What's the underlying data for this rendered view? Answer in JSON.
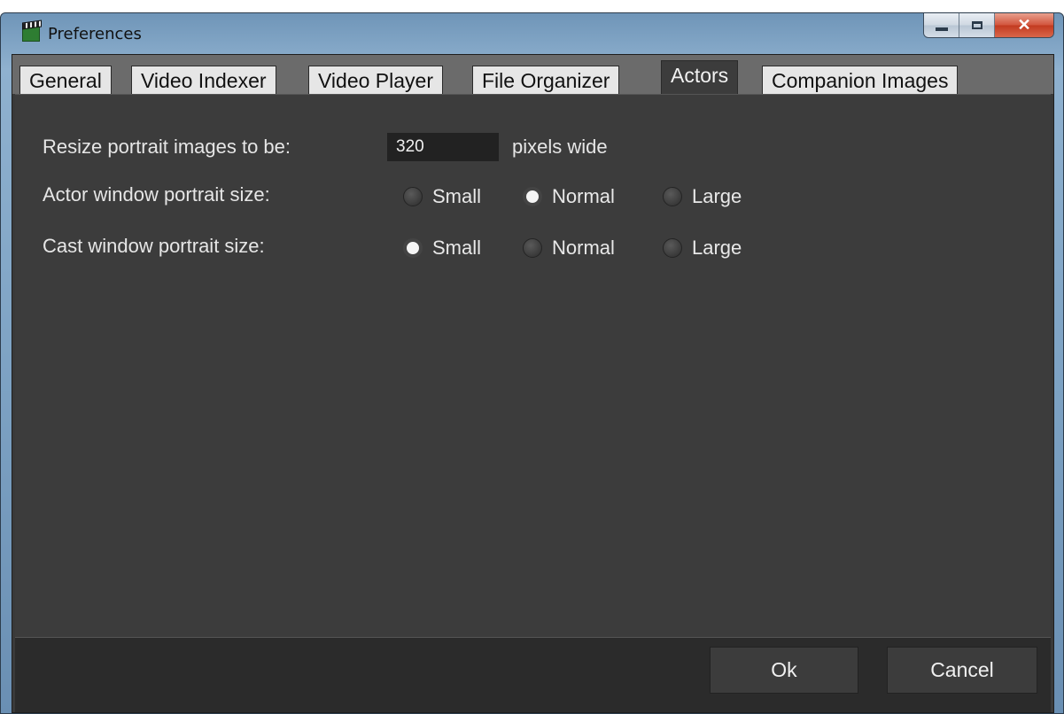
{
  "window": {
    "title": "Preferences"
  },
  "tabs": [
    {
      "label": "General",
      "active": false
    },
    {
      "label": "Video Indexer",
      "active": false
    },
    {
      "label": "Video Player",
      "active": false
    },
    {
      "label": "File Organizer",
      "active": false
    },
    {
      "label": "Actors",
      "active": true
    },
    {
      "label": "Companion Images",
      "active": false
    }
  ],
  "actors": {
    "resize_label": "Resize portrait images to be:",
    "resize_value": "320",
    "resize_unit": "pixels wide",
    "actor_label": "Actor window portrait size:",
    "cast_label": "Cast window portrait size:",
    "options": [
      "Small",
      "Normal",
      "Large"
    ],
    "actor_selected": "Normal",
    "cast_selected": "Small"
  },
  "footer": {
    "ok_label": "Ok",
    "cancel_label": "Cancel"
  },
  "colors": {
    "panel": "#3c3c3c",
    "footer": "#2b2b2b",
    "tabbar": "#6b6b6b",
    "text": "#e6e6e6"
  }
}
